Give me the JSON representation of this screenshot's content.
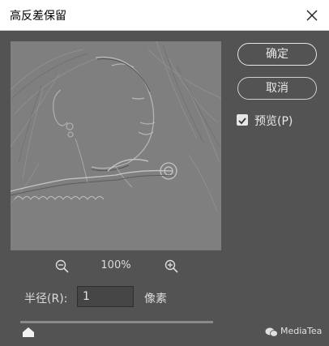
{
  "window": {
    "title": "高反差保留"
  },
  "zoom": {
    "level": "100%"
  },
  "radius": {
    "label": "半径(R):",
    "value": "1",
    "unit": "像素"
  },
  "buttons": {
    "ok_label": "确定",
    "cancel_label": "取消"
  },
  "preview_option": {
    "label": "预览(P)",
    "checked": true
  },
  "watermark": {
    "text": "MediaTea"
  },
  "colors": {
    "dialog_bg": "#535353",
    "preview_gray": "#7f7f7f",
    "text": "#dcdcdc"
  }
}
